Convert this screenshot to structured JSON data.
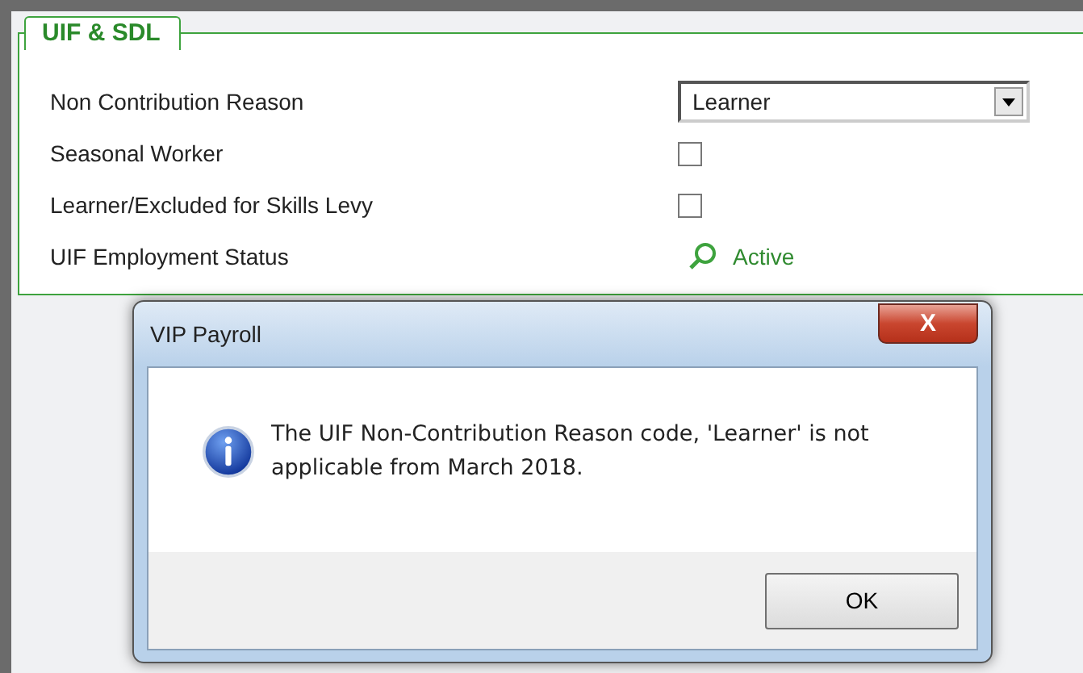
{
  "panel": {
    "title": "UIF & SDL",
    "fields": [
      {
        "kind": "select",
        "label": "Non Contribution Reason",
        "value": "Learner"
      },
      {
        "kind": "checkbox",
        "label": "Seasonal Worker",
        "checked": false
      },
      {
        "kind": "checkbox",
        "label": "Learner/Excluded for Skills Levy",
        "checked": false
      },
      {
        "kind": "status",
        "label": "UIF Employment Status",
        "value": "Active"
      }
    ]
  },
  "dialog": {
    "title": "VIP Payroll",
    "close": "X",
    "message": "The UIF Non-Contribution Reason code, 'Learner' is not applicable from March 2018.",
    "buttons": [
      "OK"
    ]
  }
}
